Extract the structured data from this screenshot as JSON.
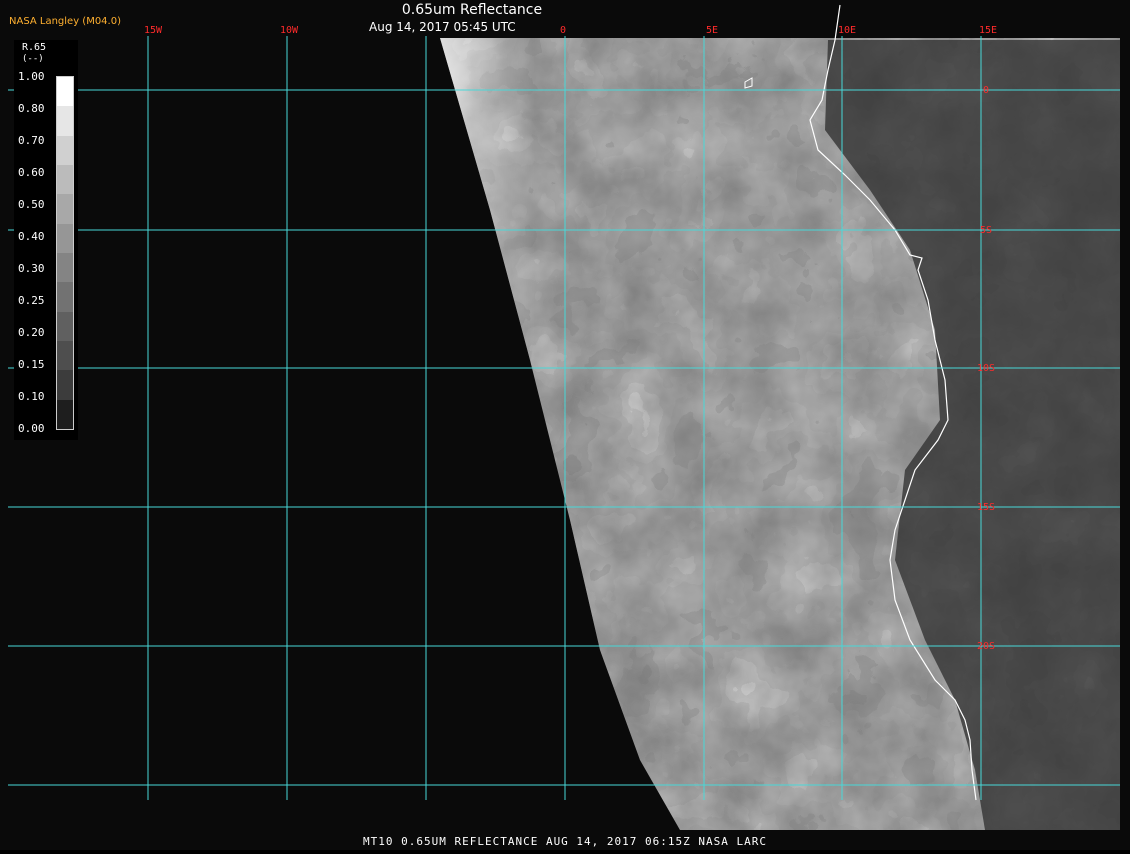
{
  "header": {
    "brand": "NASA Langley (M04.0)",
    "title": "0.65um Reflectance",
    "subtitle": "Aug 14, 2017 05:45 UTC"
  },
  "footer": "MT10  0.65UM REFLECTANCE  AUG 14, 2017 06:15Z  NASA LARC",
  "legend": {
    "title": "R.65",
    "units": "(--)",
    "ticks": [
      "1.00",
      "0.80",
      "0.70",
      "0.60",
      "0.50",
      "0.40",
      "0.30",
      "0.25",
      "0.20",
      "0.15",
      "0.10",
      "0.00"
    ],
    "grays": [
      "#ffffff",
      "#e6e6e6",
      "#d0d0d0",
      "#bbbbbb",
      "#a8a8a8",
      "#969696",
      "#848484",
      "#727272",
      "#606060",
      "#4e4e4e",
      "#3c3c3c",
      "#1e1e1e"
    ]
  },
  "map": {
    "lon_labels": [
      "15W",
      "10W",
      "0",
      "5E",
      "10E",
      "15E"
    ],
    "lat_labels": [
      "0",
      "5S",
      "10S",
      "15S",
      "20S"
    ],
    "colors": {
      "grid": "#48d8d8",
      "label": "#ff2b2b",
      "brand": "#ffb030",
      "text": "#ffffff",
      "space": "#0a0a0a",
      "coast": "#ffffff"
    }
  }
}
